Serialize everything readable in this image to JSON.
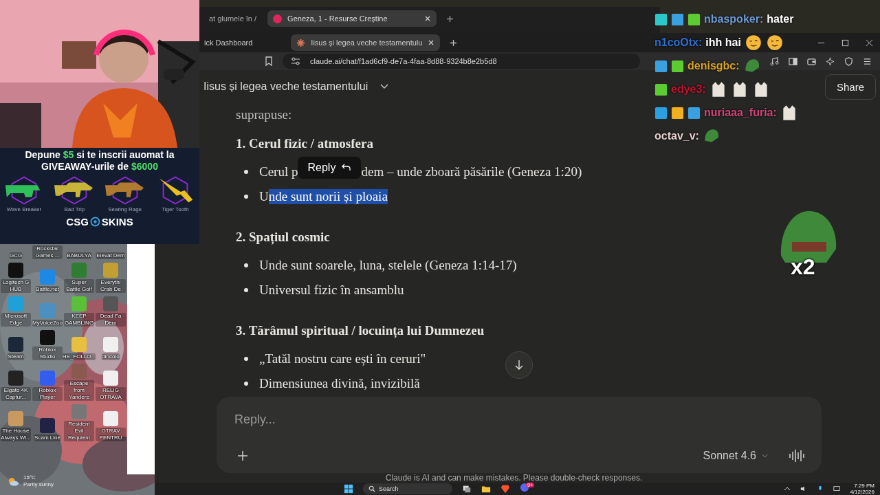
{
  "ad": {
    "lines": [
      [
        {
          "text": "Depune ",
          "highlight": false
        },
        {
          "text": "$5",
          "highlight": true
        },
        {
          "text": " si te inscrii auomat la",
          "highlight": false
        }
      ],
      [
        {
          "text": "GIVEAWAY-urile de ",
          "highlight": false
        },
        {
          "text": "$6000",
          "highlight": true
        }
      ]
    ],
    "skins": [
      {
        "name": "Wave Breaker",
        "kind": "smg",
        "color": "#2fbf5a"
      },
      {
        "name": "Bad Trip",
        "kind": "rifle",
        "color": "#c9b43a"
      },
      {
        "name": "Searing Rage",
        "kind": "rifle",
        "color": "#b07a30"
      },
      {
        "name": "Tiger Tooth",
        "kind": "knife",
        "color": "#e8c020"
      }
    ],
    "brand": [
      "CSG",
      "SKINS"
    ]
  },
  "desktop": {
    "icons": [
      {
        "label": "GCG"
      },
      {
        "label": "Rockstar Games ..."
      },
      {
        "label": "BABULYA"
      },
      {
        "label": "Elevat Dem"
      },
      {
        "label": "Logitech G HUB",
        "color": "#111111"
      },
      {
        "label": "Battle.net",
        "color": "#1e88e5"
      },
      {
        "label": "Super Battle Golf",
        "color": "#2e7d32"
      },
      {
        "label": "Everythi Crab De",
        "color": "#c0a030"
      },
      {
        "label": "Microsoft Edge",
        "color": "#1fa0d8"
      },
      {
        "label": "MyVoiceZoo",
        "color": "#4a90c0"
      },
      {
        "label": "KEEP GAMBLING",
        "color": "#5cbf3a"
      },
      {
        "label": "Dead Fa Dem",
        "color": "#555555"
      },
      {
        "label": "Steam",
        "color": "#1b2838"
      },
      {
        "label": "Roblox Studio",
        "color": "#111111"
      },
      {
        "label": "HE_FOLLO...",
        "color": "#e8c040"
      },
      {
        "label": "dincolo",
        "color": "#f0f0f0"
      },
      {
        "label": "Elgato 4K Captur...",
        "color": "#222222"
      },
      {
        "label": "Roblox Player",
        "color": "#335cf0"
      },
      {
        "label": "Escape from Yandere",
        "color": "#8a5a50"
      },
      {
        "label": "RELIG OTRAVA",
        "color": "#f0f0f0"
      },
      {
        "label": "The House Always Wi...",
        "color": "#c89a60"
      },
      {
        "label": "Scam Line",
        "color": "#222244"
      },
      {
        "label": "Resident Evil Requiem",
        "color": "#777777"
      },
      {
        "label": "OTRAV PENTRU",
        "color": "#f0f0f0"
      }
    ]
  },
  "weather": {
    "temp": "15°C",
    "condition": "Partly sunny"
  },
  "back_browser": {
    "tabs": [
      {
        "title": "at glumele în /",
        "selected": false
      },
      {
        "title": "Geneza, 1 - Resurse Creștine",
        "selected": true
      }
    ]
  },
  "browser": {
    "tabs": [
      {
        "title": "ick Dashboard",
        "selected": false
      },
      {
        "title": "Iisus și legea veche testamentulu",
        "selected": true
      }
    ],
    "url": "claude.ai/chat/f1ad6cf9-de7a-4faa-8d88-9324b8e2b5d8"
  },
  "chat": {
    "title": "Iisus și legea veche testamentului",
    "share": "Share",
    "intro": "suprapuse:",
    "sections": [
      {
        "heading": "1. Cerul fizic / atmosfera",
        "bullets": [
          {
            "segments": [
              {
                "text": "Cerul p",
                "selected": false
              },
              {
                "text": "dem – unde zboară păsările (Geneza 1:20)",
                "selected": false
              }
            ],
            "tooltip": "Reply"
          },
          {
            "segments": [
              {
                "text": "U",
                "selected": false
              },
              {
                "text": "nde sunt norii și ploaia",
                "selected": true
              }
            ]
          }
        ]
      },
      {
        "heading": "2. Spațiul cosmic",
        "bullets": [
          {
            "segments": [
              {
                "text": "Unde sunt soarele, luna, stelele (Geneza 1:14-17)",
                "selected": false
              }
            ]
          },
          {
            "segments": [
              {
                "text": "Universul fizic în ansamblu",
                "selected": false
              }
            ]
          }
        ]
      },
      {
        "heading": "3. Tărâmul spiritual / locuința lui Dumnezeu",
        "bullets": [
          {
            "segments": [
              {
                "text": "„Tatăl nostru care ești în ceruri\"",
                "selected": false
              }
            ]
          },
          {
            "segments": [
              {
                "text": "Dimensiunea divină, invizibilă",
                "selected": false
              }
            ]
          }
        ]
      }
    ],
    "placeholder": "Reply...",
    "model": "Sonnet 4.6",
    "disclaimer": "Claude is AI and can make mistakes. Please double-check responses."
  },
  "stream_chat": [
    {
      "user": "nbaspoker:",
      "color": "#6f9ad8",
      "text": "hater",
      "badges": [
        {
          "kind": "tenure"
        },
        {
          "kind": "bot"
        },
        {
          "kind": "gift"
        }
      ]
    },
    {
      "user": "n1coOtx:",
      "color": "#2e6fd0",
      "text": "ihh hai",
      "emotes": [
        {
          "kind": "wink"
        },
        {
          "kind": "wink"
        }
      ]
    },
    {
      "user": "denisgbc:",
      "color": "#daa520",
      "badges": [
        {
          "kind": "bot"
        },
        {
          "kind": "gift"
        }
      ],
      "emotes": [
        {
          "kind": "pepe"
        }
      ]
    },
    {
      "user": "edye3:",
      "color": "#c8102e",
      "badges": [
        {
          "kind": "gift"
        }
      ],
      "emotes": [
        {
          "kind": "cat"
        },
        {
          "kind": "cat"
        },
        {
          "kind": "cat"
        }
      ]
    },
    {
      "user": "nuriaaa_furia:",
      "color": "#d0457a",
      "badges": [
        {
          "kind": "mod"
        },
        {
          "kind": "crown"
        },
        {
          "kind": "bot"
        }
      ],
      "emotes": [
        {
          "kind": "cat"
        }
      ]
    },
    {
      "user": "octav_v:",
      "color": "#e8cfcf",
      "emotes": [
        {
          "kind": "pepe"
        }
      ]
    }
  ],
  "overlay_emote": {
    "count": "x2"
  },
  "taskbar": {
    "search": "Search",
    "badge": "9+",
    "time": "7:29 PM",
    "date": "4/12/2026"
  }
}
